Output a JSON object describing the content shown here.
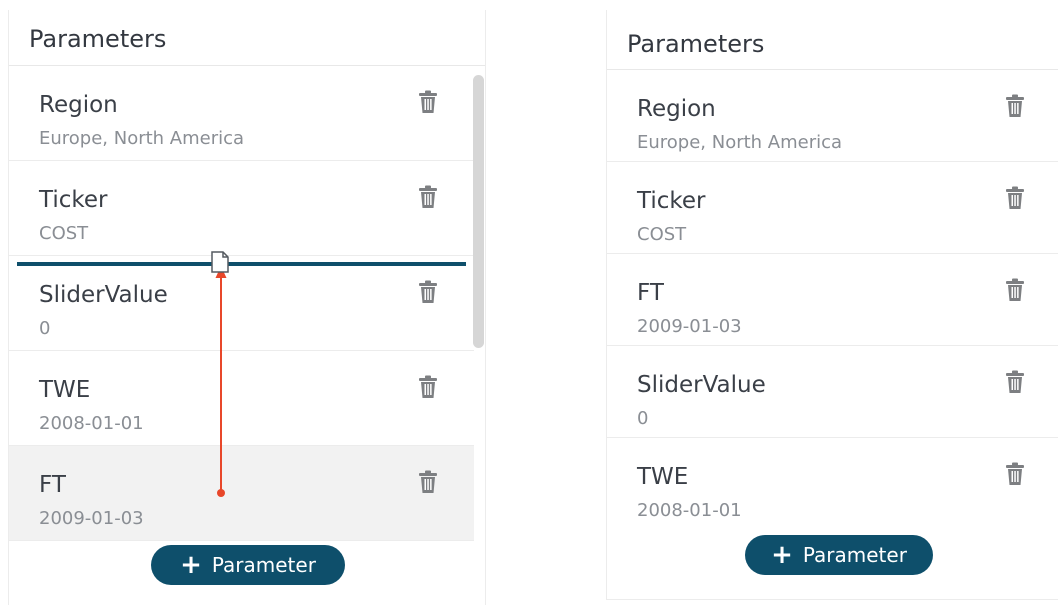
{
  "colors": {
    "accent": "#0e4f6b",
    "drag_arrow": "#e8472a"
  },
  "left_panel": {
    "title": "Parameters",
    "items": [
      {
        "name": "Region",
        "value": "Europe, North America"
      },
      {
        "name": "Ticker",
        "value": "COST"
      },
      {
        "name": "SliderValue",
        "value": "0"
      },
      {
        "name": "TWE",
        "value": "2008-01-01"
      },
      {
        "name": "FT",
        "value": "2009-01-03"
      }
    ],
    "add_button_label": "Parameter"
  },
  "right_panel": {
    "title": "Parameters",
    "items": [
      {
        "name": "Region",
        "value": "Europe, North America"
      },
      {
        "name": "Ticker",
        "value": "COST"
      },
      {
        "name": "FT",
        "value": "2009-01-03"
      },
      {
        "name": "SliderValue",
        "value": "0"
      },
      {
        "name": "TWE",
        "value": "2008-01-01"
      }
    ],
    "add_button_label": "Parameter"
  },
  "icons": {
    "delete": "trash-icon",
    "add": "plus-icon",
    "drag": "document-icon"
  }
}
